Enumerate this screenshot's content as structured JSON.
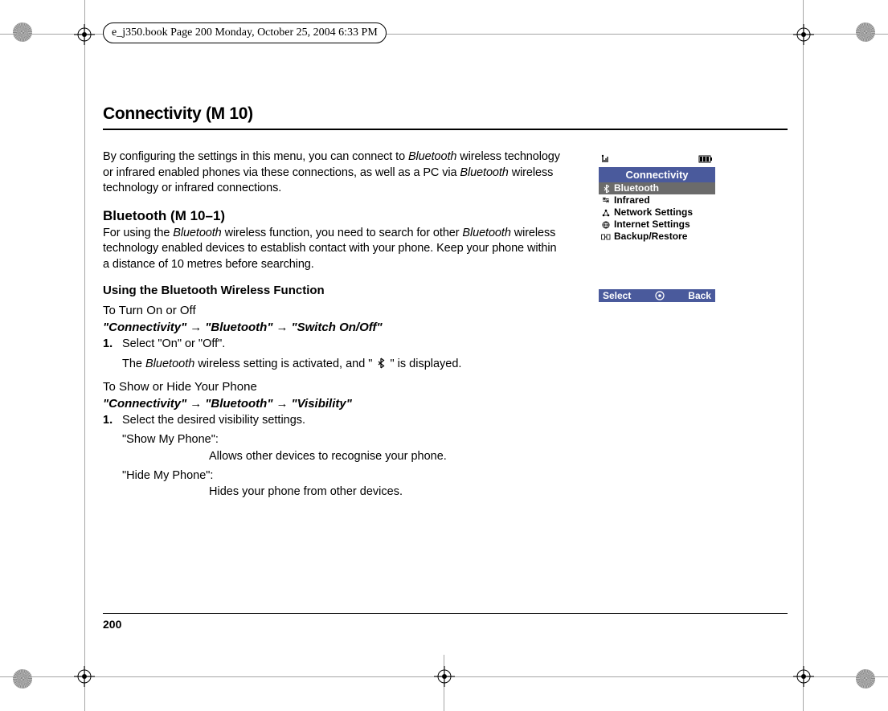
{
  "header": "e_j350.book  Page 200  Monday, October 25, 2004  6:33 PM",
  "h1": "Connectivity (M 10)",
  "intro": {
    "pre1": "By configuring the settings in this menu, you can connect to ",
    "bt1": "Bluetooth",
    "mid1": " wireless technology or infrared enabled phones via these connections, as well as a PC via ",
    "bt2": "Bluetooth",
    "post1": " wireless technology or infrared connections."
  },
  "h2_bluetooth": "Bluetooth (M 10–1)",
  "bt_intro": {
    "pre": "For using the ",
    "bt1": "Bluetooth",
    "mid": " wireless function, you need to search for other ",
    "bt2": "Bluetooth",
    "post": " wireless technology enabled devices to establish contact with your phone. Keep your phone within a distance of 10 metres before searching."
  },
  "h3_using": "Using the Bluetooth Wireless Function",
  "h4_turn": "To Turn On or Off",
  "nav1": {
    "a": "\"Connectivity\"",
    "b": "\"Bluetooth\"",
    "c": "\"Switch On/Off\""
  },
  "step1_num": "1.",
  "step1_text": "Select \"On\" or \"Off\".",
  "step1_sub_pre": "The ",
  "step1_sub_bt": "Bluetooth",
  "step1_sub_mid": " wireless setting is activated, and \" ",
  "step1_sub_post": " \" is displayed.",
  "h4_show": "To Show or Hide Your Phone",
  "nav2": {
    "a": "\"Connectivity\"",
    "b": "\"Bluetooth\"",
    "c": "\"Visibility\""
  },
  "step2_num": "1.",
  "step2_text": "Select the desired visibility settings.",
  "vis1_label": "\"Show My Phone\":",
  "vis1_desc": "Allows other devices to recognise your phone.",
  "vis2_label": "\"Hide My Phone\":",
  "vis2_desc": "Hides your phone from other devices.",
  "page_number": "200",
  "phone": {
    "title": "Connectivity",
    "items": [
      {
        "label": "Bluetooth",
        "selected": true
      },
      {
        "label": "Infrared",
        "selected": false
      },
      {
        "label": "Network Settings",
        "selected": false
      },
      {
        "label": "Internet Settings",
        "selected": false
      },
      {
        "label": "Backup/Restore",
        "selected": false
      }
    ],
    "soft_left": "Select",
    "soft_right": "Back"
  }
}
